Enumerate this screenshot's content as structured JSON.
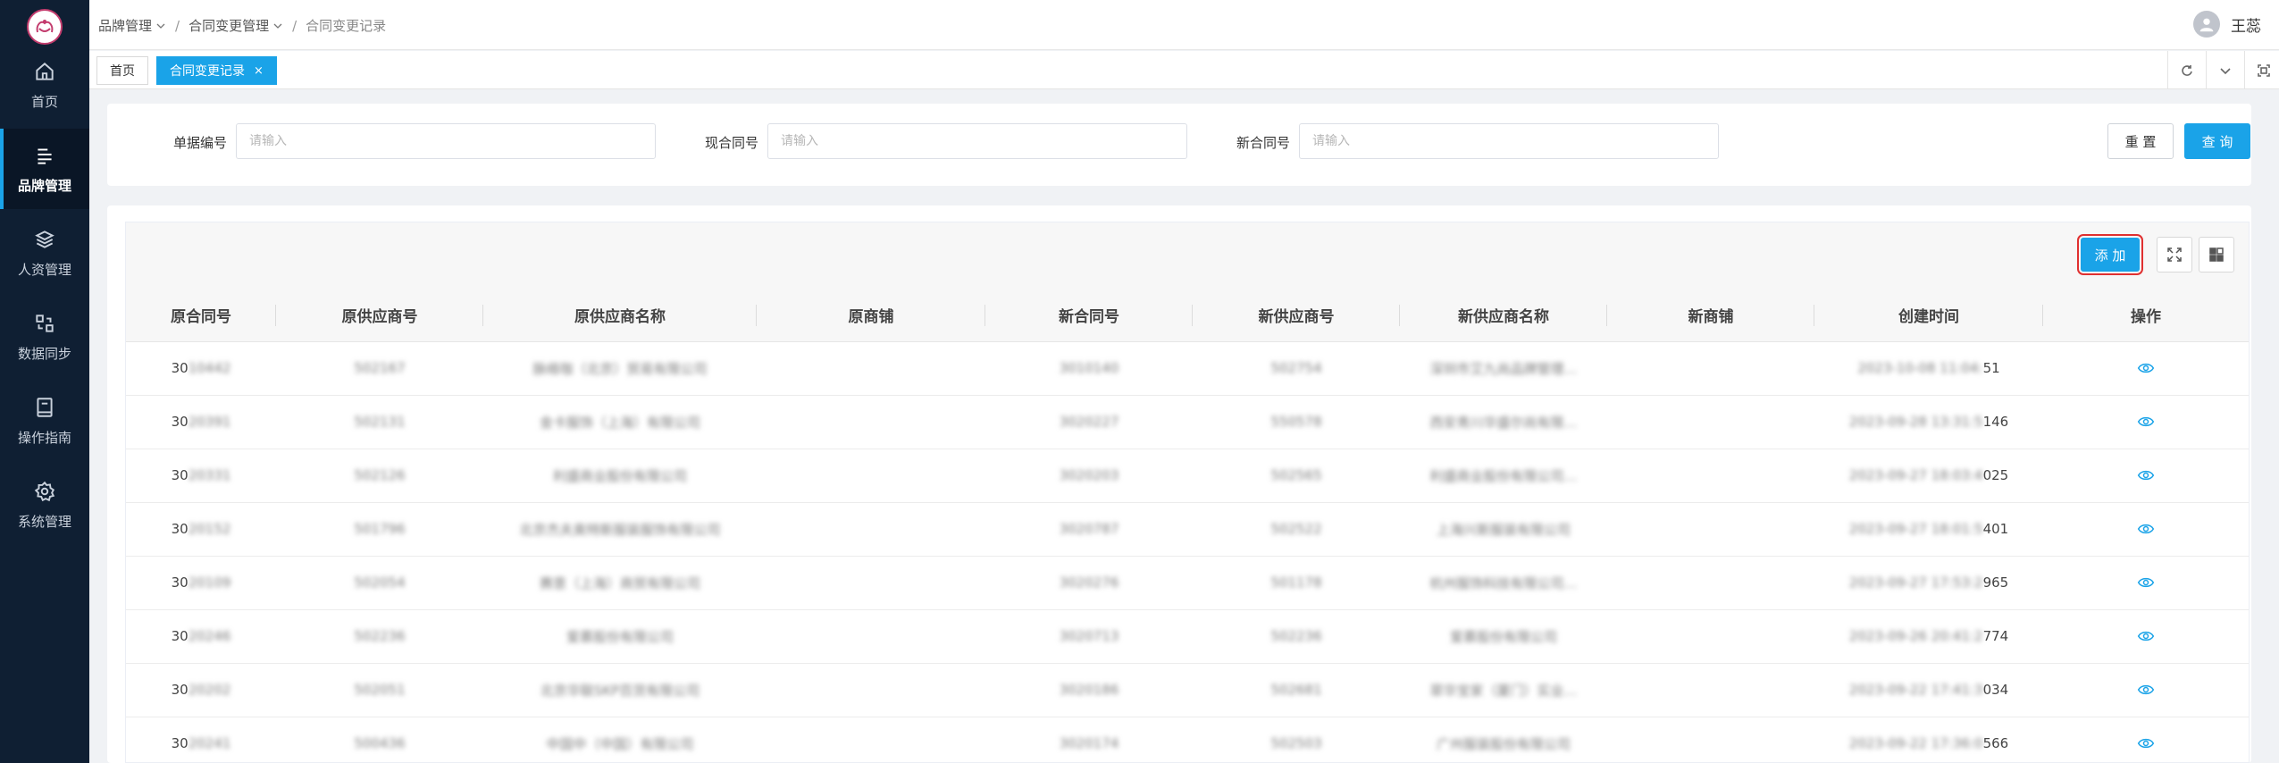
{
  "sidebar": {
    "items": [
      {
        "label": "首页",
        "icon": "home-icon"
      },
      {
        "label": "品牌管理",
        "icon": "menu-lines-icon",
        "active": true
      },
      {
        "label": "人资管理",
        "icon": "layers-icon"
      },
      {
        "label": "数据同步",
        "icon": "sync-icon"
      },
      {
        "label": "操作指南",
        "icon": "book-icon"
      },
      {
        "label": "系统管理",
        "icon": "gear-icon"
      }
    ]
  },
  "header": {
    "breadcrumb": [
      "品牌管理",
      "合同变更管理",
      "合同变更记录"
    ],
    "user_name": "王蕊"
  },
  "tabs": [
    {
      "label": "首页"
    },
    {
      "label": "合同变更记录",
      "active": true,
      "close": "×"
    }
  ],
  "search": {
    "fields": [
      {
        "label": "单据编号",
        "placeholder": "请输入",
        "value": ""
      },
      {
        "label": "现合同号",
        "placeholder": "请输入",
        "value": ""
      },
      {
        "label": "新合同号",
        "placeholder": "请输入",
        "value": ""
      }
    ],
    "reset_label": "重 置",
    "query_label": "查 询"
  },
  "table": {
    "add_label": "添 加",
    "columns": [
      "原合同号",
      "原供应商号",
      "原供应商名称",
      "原商铺",
      "新合同号",
      "新供应商号",
      "新供应商名称",
      "新商铺",
      "创建时间",
      "操作"
    ],
    "rows": [
      {
        "contract_prefix": "30",
        "contract_rest": "10442",
        "supplier_no": "502167",
        "supplier_name": "脉络咖（北京）贸易有限公司",
        "shop": "",
        "new_contract": "3010140",
        "new_supplier_no": "502754",
        "new_supplier_name": "深圳市艾九尚品牌管理…",
        "new_shop": "",
        "time_blur": "2023-10-08 11:04:",
        "time_tail": "51"
      },
      {
        "contract_prefix": "30",
        "contract_rest": "20391",
        "supplier_no": "502131",
        "supplier_name": "金卡服饰（上海）有限公司",
        "shop": "",
        "new_contract": "3020227",
        "new_supplier_no": "550578",
        "new_supplier_name": "西安青川华盛尔尚有限…",
        "new_shop": "",
        "time_blur": "2023-09-28 13:31:5",
        "time_tail": "146"
      },
      {
        "contract_prefix": "30",
        "contract_rest": "20331",
        "supplier_no": "502126",
        "supplier_name": "利盛商业股份有限公司",
        "shop": "",
        "new_contract": "3020203",
        "new_supplier_no": "502565",
        "new_supplier_name": "利盛商业股份有限公司…",
        "new_shop": "",
        "time_blur": "2023-09-27 18:03:4",
        "time_tail": "025"
      },
      {
        "contract_prefix": "30",
        "contract_rest": "20152",
        "supplier_no": "501796",
        "supplier_name": "北京杰夫奥特斯服装服饰有限公司",
        "shop": "",
        "new_contract": "3020787",
        "new_supplier_no": "502522",
        "new_supplier_name": "上海兴斯服装有限公司",
        "new_shop": "",
        "time_blur": "2023-09-27 18:01:5",
        "time_tail": "401"
      },
      {
        "contract_prefix": "30",
        "contract_rest": "20109",
        "supplier_no": "502054",
        "supplier_name": "赛意（上海）商贸有限公司",
        "shop": "",
        "new_contract": "3020276",
        "new_supplier_no": "501178",
        "new_supplier_name": "杭州服饰科技有限公司…",
        "new_shop": "",
        "time_blur": "2023-09-27 17:53:2",
        "time_tail": "965"
      },
      {
        "contract_prefix": "30",
        "contract_rest": "20246",
        "supplier_no": "502236",
        "supplier_name": "爱慕股份有限公司",
        "shop": "",
        "new_contract": "3020713",
        "new_supplier_no": "502236",
        "new_supplier_name": "爱慕股份有限公司",
        "new_shop": "",
        "time_blur": "2023-09-26 20:41:2",
        "time_tail": "774"
      },
      {
        "contract_prefix": "30",
        "contract_rest": "20202",
        "supplier_no": "502051",
        "supplier_name": "北京华联SKP百货有限公司",
        "shop": "",
        "new_contract": "3020186",
        "new_supplier_no": "502681",
        "new_supplier_name": "翠华宝家（厦门）实业…",
        "new_shop": "",
        "time_blur": "2023-09-22 17:41:3",
        "time_tail": "034"
      },
      {
        "contract_prefix": "30",
        "contract_rest": "20241",
        "supplier_no": "500436",
        "supplier_name": "中国中（中国）有限公司",
        "shop": "",
        "new_contract": "3020174",
        "new_supplier_no": "502503",
        "new_supplier_name": "广州服装股份有限公司",
        "new_shop": "",
        "time_blur": "2023-09-22 17:36:0",
        "time_tail": "566"
      }
    ]
  },
  "colors": {
    "sidebar_bg": "#0f1f33",
    "accent": "#1aa3e8",
    "highlight": "#e03030"
  }
}
